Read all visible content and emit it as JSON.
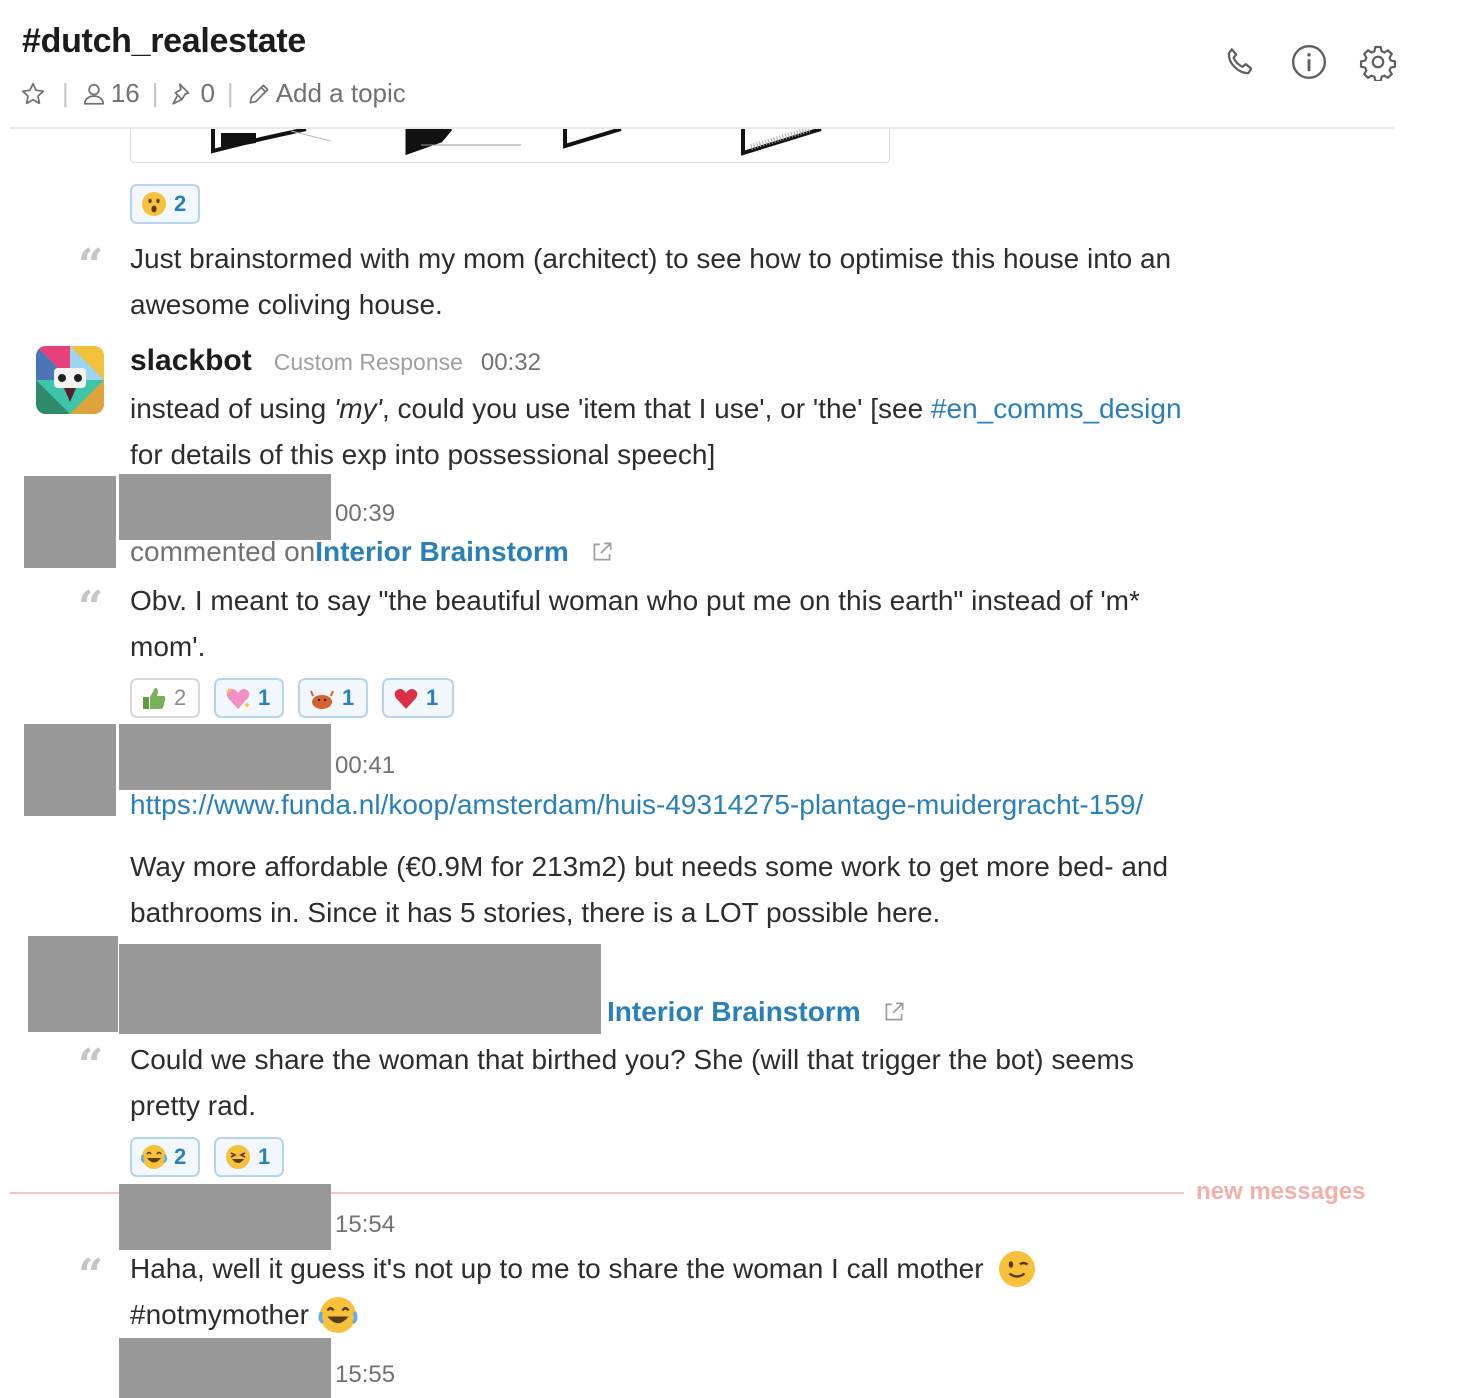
{
  "header": {
    "channel": "#dutch_realestate",
    "members": "16",
    "pins": "0",
    "topic_placeholder": "Add a topic"
  },
  "icons": [
    "star-icon",
    "member-icon",
    "pin-icon",
    "pencil-icon",
    "phone-icon",
    "info-icon",
    "gear-icon",
    "quote-icon",
    "external-link-icon"
  ],
  "colors": {
    "link": "#2a80b9",
    "new_messages": "#f2b0ab",
    "redaction": "#999999"
  },
  "messages": {
    "m1": {
      "reactions": [
        {
          "emoji": "astonished",
          "count": "2"
        }
      ],
      "lines": [
        "Just brainstormed with my mom (architect) to see how to optimise this house into an",
        "awesome coliving house."
      ]
    },
    "slackbot": {
      "name": "slackbot",
      "tag": "Custom Response",
      "time": "00:32",
      "line1_a": "instead of using ",
      "line1_em": "'my'",
      "line1_b": ", could you use 'item that I use', or 'the' [see ",
      "line1_link": "#en_comms_design",
      "line2": "for details of this exp into possessional speech]"
    },
    "m3": {
      "time": "00:39",
      "action": "commented on ",
      "file": "Interior Brainstorm",
      "lines": [
        "Obv. I meant to say \"the beautiful woman who put me on this earth\" instead of 'm*",
        "mom'."
      ],
      "reactions": [
        {
          "emoji": "thumbsup",
          "count": "2"
        },
        {
          "emoji": "sparkling-heart",
          "count": "1"
        },
        {
          "emoji": "crab",
          "count": "1"
        },
        {
          "emoji": "heart",
          "count": "1"
        }
      ]
    },
    "m4": {
      "time": "00:41",
      "url": "https://www.funda.nl/koop/amsterdam/huis-49314275-plantage-muidergracht-159/",
      "lines": [
        "Way more affordable (€0.9M for 213m2) but needs some work to get more bed- and",
        "bathrooms in. Since it has 5 stories, there is a LOT possible here."
      ]
    },
    "m5": {
      "file": "Interior Brainstorm",
      "lines": [
        "Could we share the woman that birthed you? She (will that trigger the bot) seems",
        "pretty rad."
      ],
      "reactions": [
        {
          "emoji": "joy",
          "count": "2"
        },
        {
          "emoji": "laughing",
          "count": "1"
        }
      ]
    },
    "divider": {
      "label": "new messages"
    },
    "m6": {
      "time": "15:54",
      "line1": "Haha, well it guess it's not up to me to share the woman I call mother",
      "line2": "#notmymother"
    },
    "m7": {
      "time": "15:55"
    }
  }
}
